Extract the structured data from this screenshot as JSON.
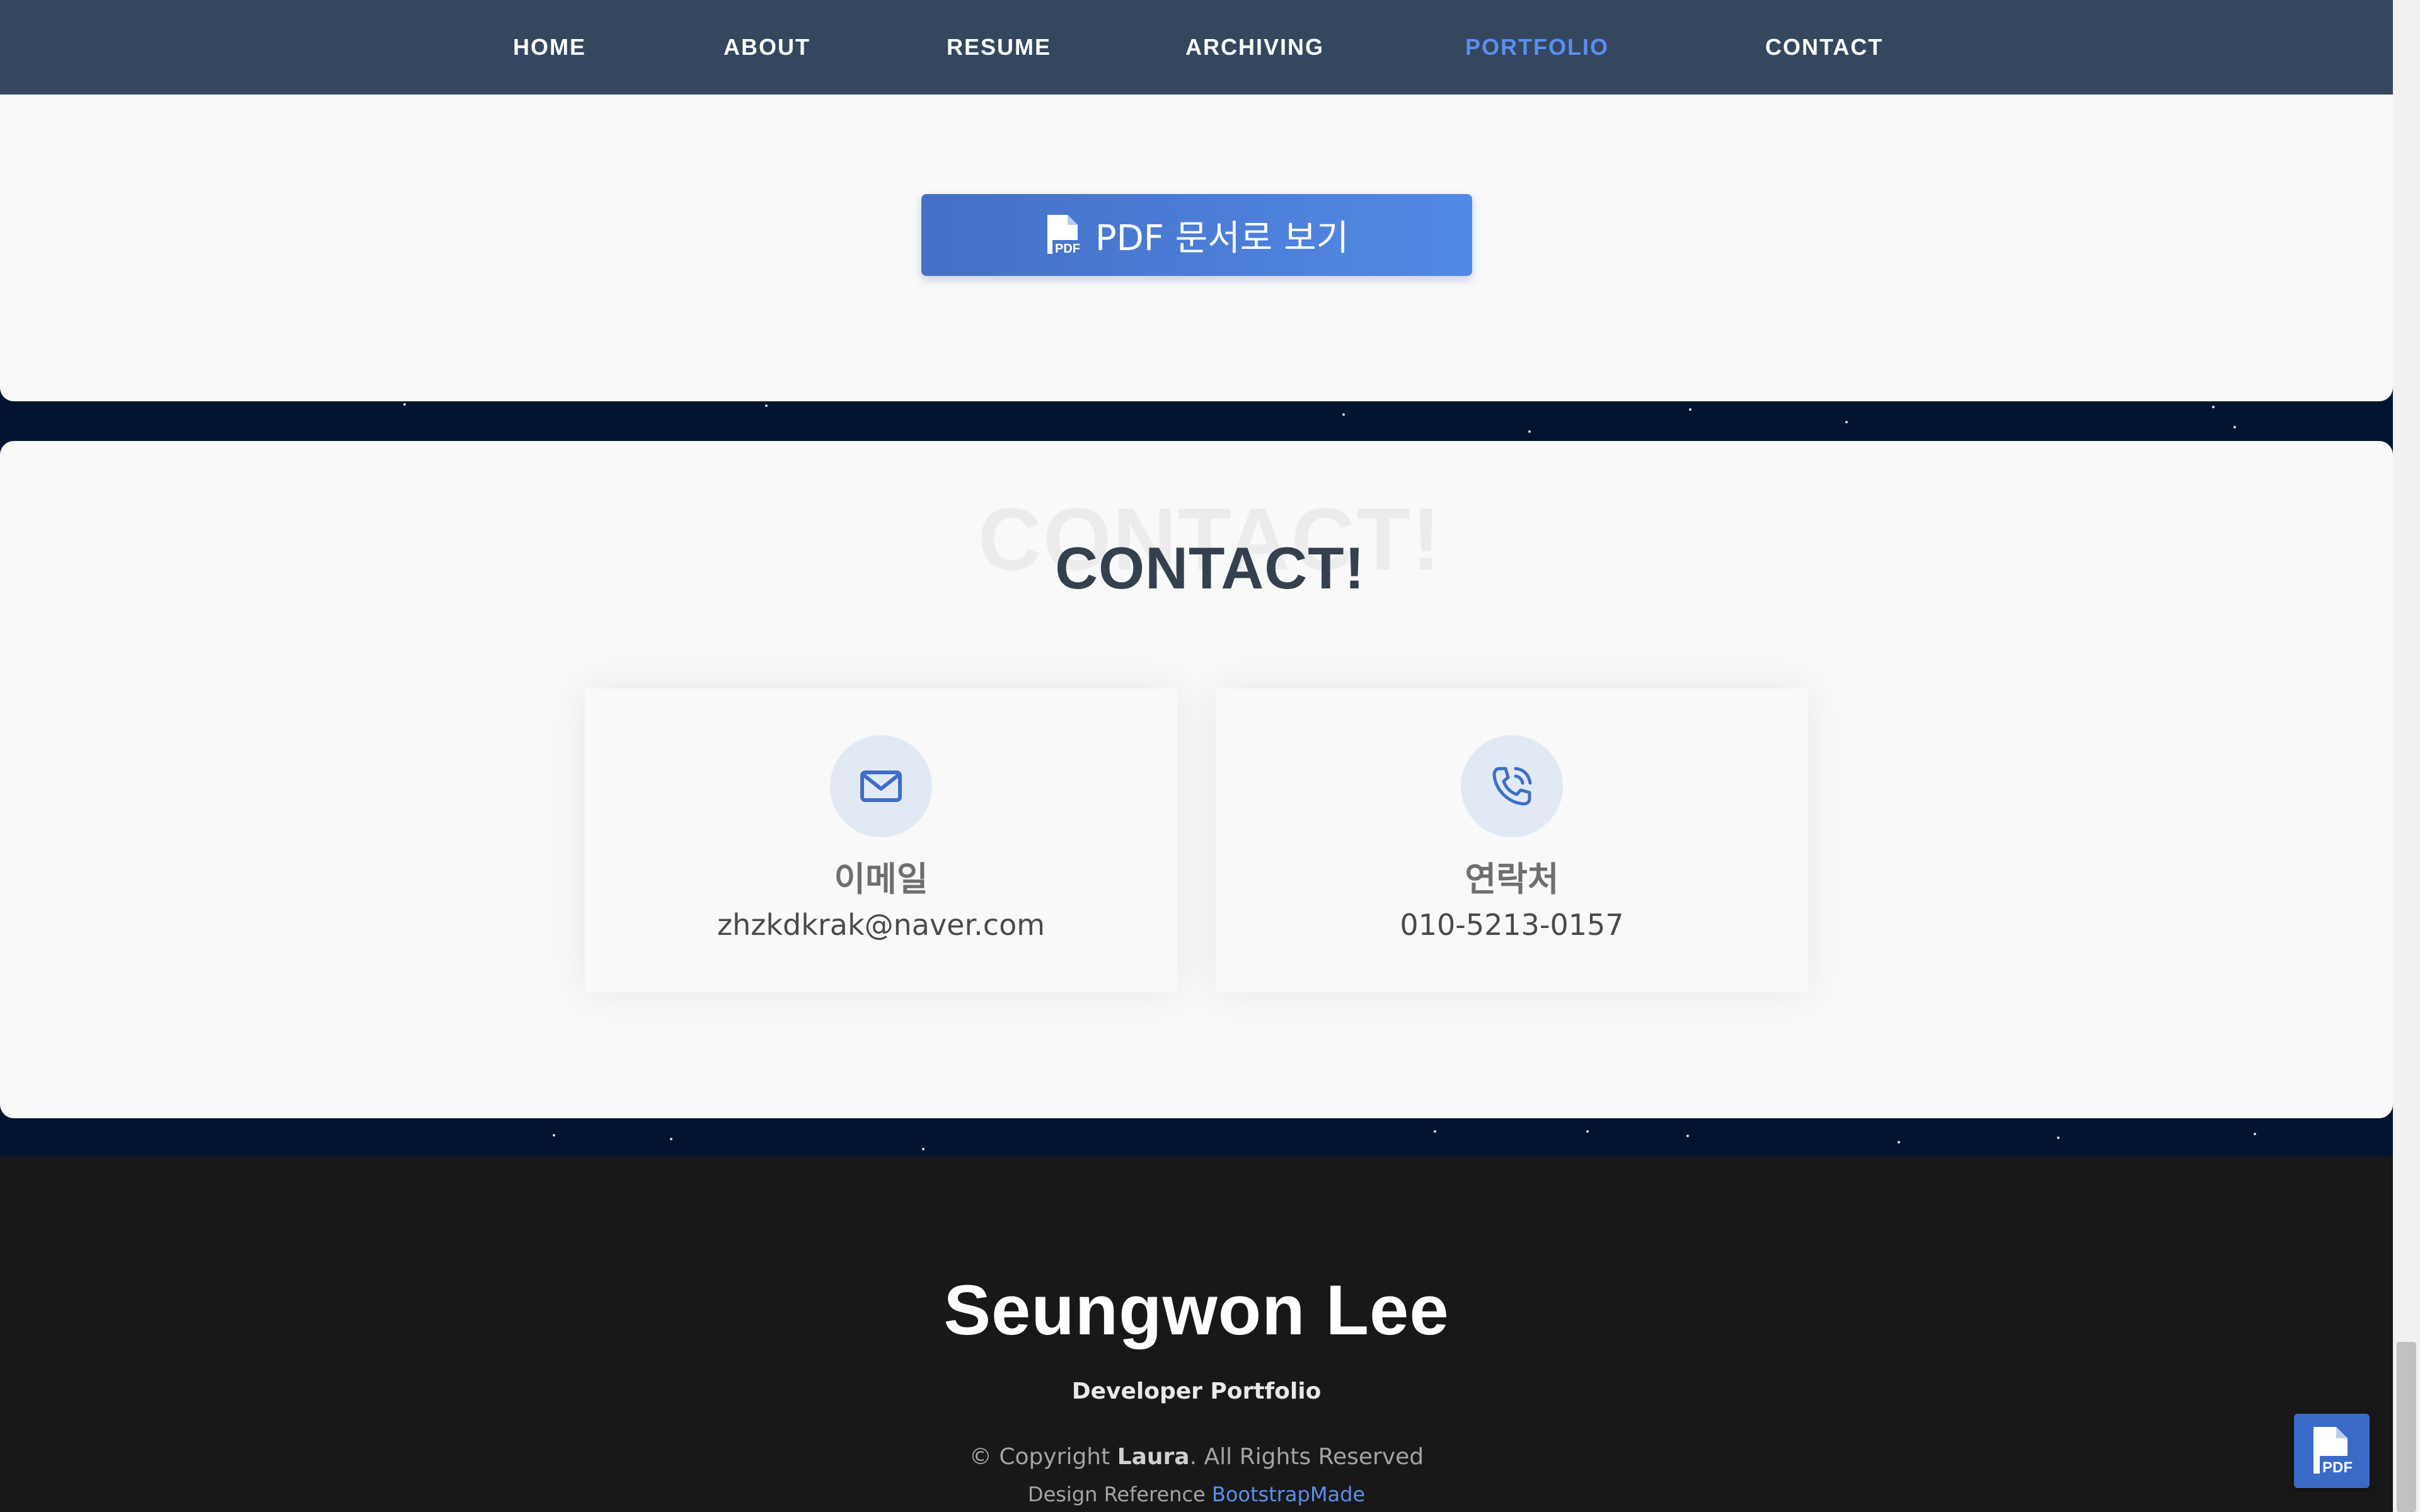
{
  "nav": {
    "items": [
      {
        "label": "HOME",
        "active": false
      },
      {
        "label": "ABOUT",
        "active": false
      },
      {
        "label": "RESUME",
        "active": false
      },
      {
        "label": "ARCHIVING",
        "active": false
      },
      {
        "label": "PORTFOLIO",
        "active": true
      },
      {
        "label": "CONTACT",
        "active": false
      }
    ]
  },
  "portfolio": {
    "pdf_button_label": "PDF 문서로 보기",
    "pdf_icon": "file-pdf-icon"
  },
  "contact": {
    "ghost_title": "CONTACT!",
    "title": "CONTACT!",
    "email": {
      "icon": "envelope-icon",
      "title": "이메일",
      "value": "zhzkdkrak@naver.com"
    },
    "phone": {
      "icon": "phone-icon",
      "title": "연락처",
      "value": "010-5213-0157"
    }
  },
  "footer": {
    "name": "Seungwon Lee",
    "subtitle": "Developer Portfolio",
    "copyright_prefix": "© Copyright",
    "copyright_owner": "Laura",
    "copyright_suffix": ". All Rights Reserved",
    "design_ref_prefix": "Design Reference",
    "design_ref_link": "BootstrapMade"
  },
  "floating_button": {
    "icon": "file-pdf-icon"
  },
  "colors": {
    "nav_bg": "#34475f",
    "nav_active": "#5b8ff0",
    "button_gradient_start": "#4470c6",
    "button_gradient_end": "#5289e6",
    "footer_bg": "#181818",
    "space_bg": "#021530"
  }
}
